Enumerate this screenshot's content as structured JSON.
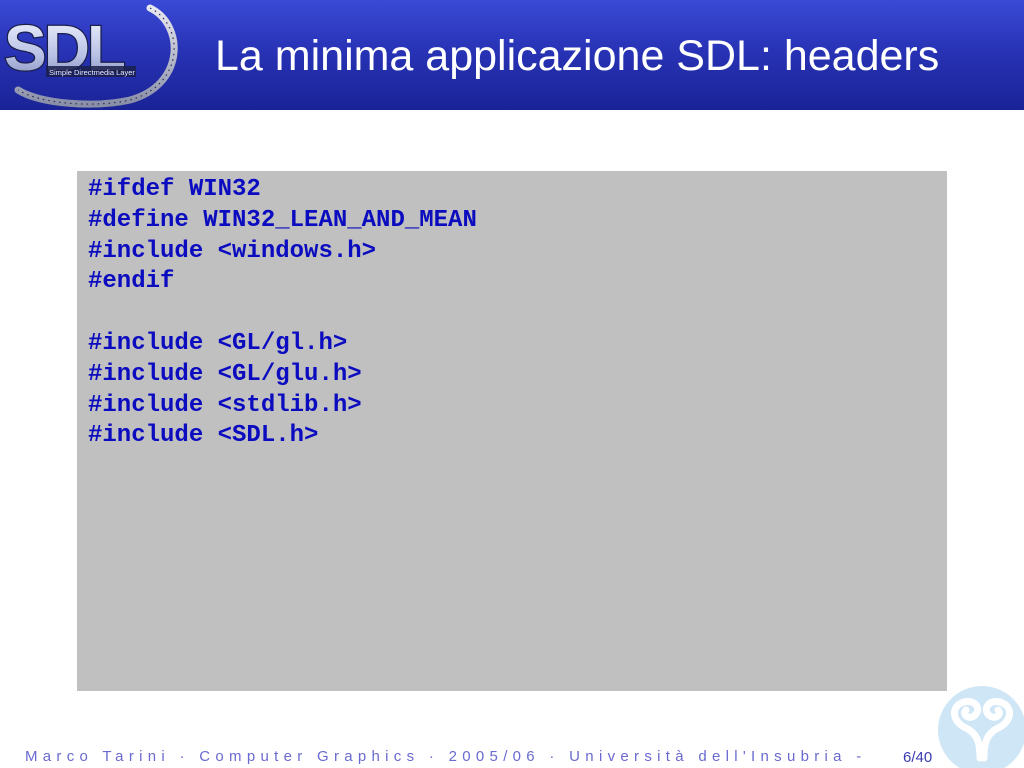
{
  "header": {
    "title": "La minima applicazione SDL: headers",
    "logo_text": "SDL",
    "logo_subtext": "Simple Directmedia Layer"
  },
  "code": {
    "lines": [
      "#ifdef WIN32",
      "#define WIN32_LEAN_AND_MEAN",
      "#include <windows.h>",
      "#endif",
      "",
      "#include <GL/gl.h>",
      "#include <GL/glu.h>",
      "#include <stdlib.h>",
      "#include <SDL.h>"
    ]
  },
  "footer": {
    "text": "Marco Tarini · Computer  Graphics · 2005/06 · Università dell'Insubria -",
    "page": "6/40"
  },
  "colors": {
    "header_bg": "#2833b6",
    "code_bg": "#c0c0c0",
    "code_text": "#0b0bbf",
    "footer_text": "#6a6ad0"
  }
}
